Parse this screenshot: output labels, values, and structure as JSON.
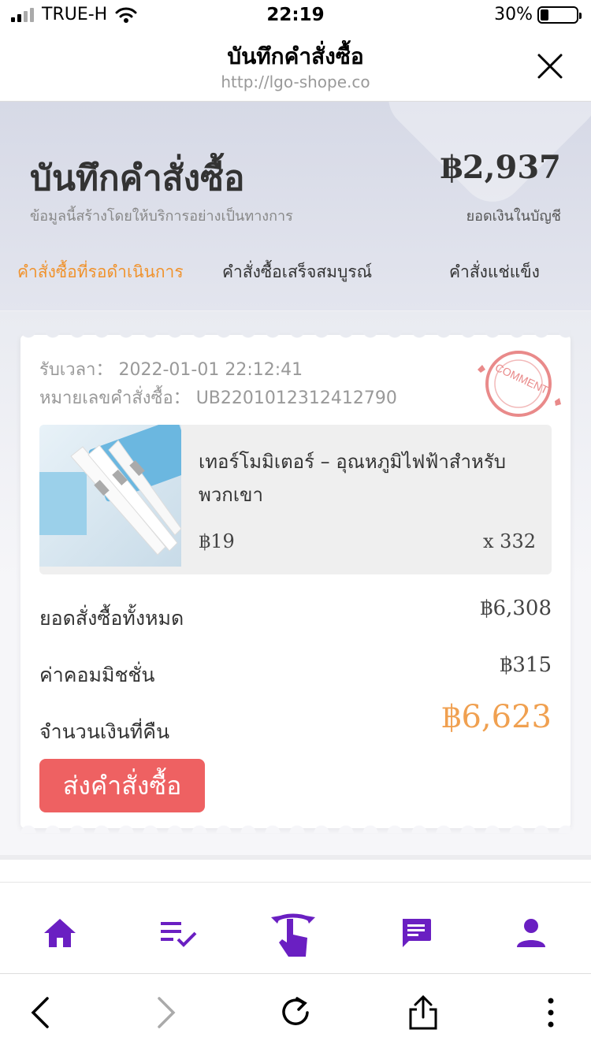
{
  "status_bar": {
    "carrier": "TRUE-H",
    "time": "22:19",
    "battery": "30%"
  },
  "browser": {
    "page_title": "บันทึกคำสั่งซื้อ",
    "url": "http://lgo-shope.co"
  },
  "hero": {
    "title": "บันทึกคำสั่งซื้อ",
    "subtitle": "ข้อมูลนี้สร้างโดยให้บริการอย่างเป็นทางการ",
    "balance": "฿2,937",
    "balance_label": "ยอดเงินในบัญชี"
  },
  "tabs": [
    {
      "label": "คำสั่งซื้อที่รอดำเนินการ",
      "active": true
    },
    {
      "label": "คำสั่งซื้อเสร็จสมบูรณ์",
      "active": false
    },
    {
      "label": "คำสั่งแช่แข็ง",
      "active": false
    }
  ],
  "order": {
    "time_label": "รับเวลา：",
    "time_value": "2022-01-01 22:12:41",
    "number_label": "หมายเลขคำสั่งซื้อ：",
    "number_value": "UB2201012312412790",
    "stamp_text": "COMMENT",
    "product": {
      "name": "เทอร์โมมิเตอร์ – อุณหภูมิไฟฟ้าสำหรับพวกเขา",
      "price": "฿19",
      "quantity": "x 332"
    },
    "total_label": "ยอดสั่งซื้อทั้งหมด",
    "total_value": "฿6,308",
    "commission_label": "ค่าคอมมิชชั่น",
    "commission_value": "฿315",
    "refund_label": "จำนวนเงินที่คืน",
    "refund_value": "฿6,623",
    "submit_label": "ส่งคำสั่งซื้อ"
  },
  "bottom_nav": [
    "home-icon",
    "task-list-icon",
    "tap-hand-icon",
    "message-icon",
    "profile-icon"
  ],
  "browser_toolbar": [
    "back-icon",
    "forward-icon",
    "reload-icon",
    "share-icon",
    "more-icon"
  ],
  "colors": {
    "accent_purple": "#6a1fc2",
    "active_tab": "#f0922c",
    "refund": "#f0a050",
    "button_red": "#ee6162"
  }
}
